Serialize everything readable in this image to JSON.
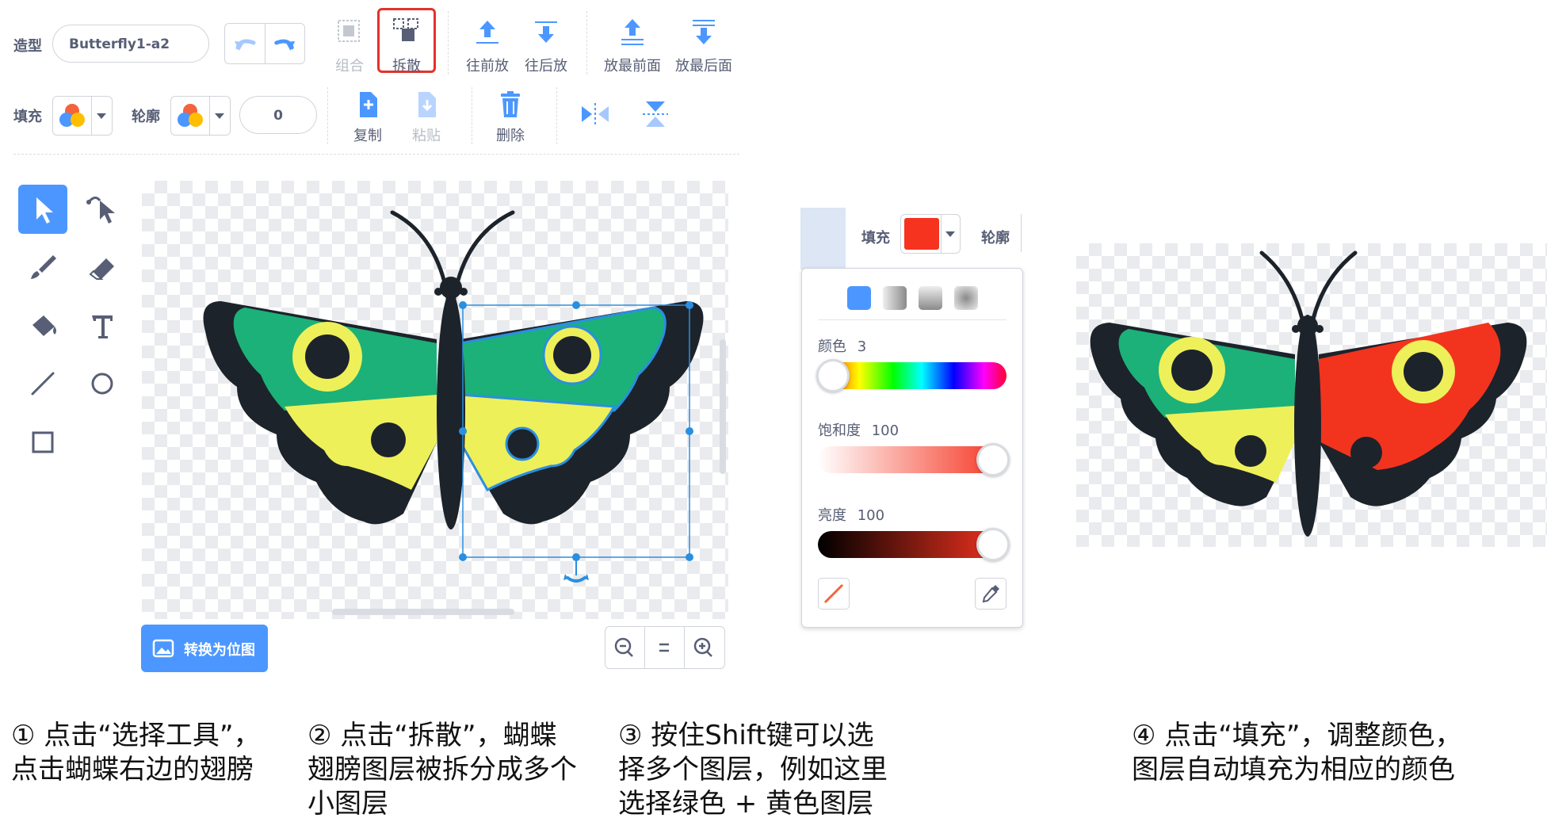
{
  "toolbar": {
    "costume_label": "造型",
    "costume_name": "Butterfly1-a2",
    "group_label": "组合",
    "ungroup_label": "拆散",
    "forward_label": "往前放",
    "backward_label": "往后放",
    "front_label": "放最前面",
    "back_label": "放最后面",
    "fill_label": "填充",
    "outline_label": "轮廓",
    "outline_width": "0",
    "copy_label": "复制",
    "paste_label": "粘贴",
    "delete_label": "删除"
  },
  "tools": [
    {
      "name": "select-tool",
      "active": true
    },
    {
      "name": "reshape-tool"
    },
    {
      "name": "brush-tool"
    },
    {
      "name": "eraser-tool"
    },
    {
      "name": "fill-tool"
    },
    {
      "name": "text-tool"
    },
    {
      "name": "line-tool"
    },
    {
      "name": "circle-tool"
    },
    {
      "name": "rectangle-tool"
    }
  ],
  "canvas": {
    "convert_button_label": "转换为位图"
  },
  "picker": {
    "fill_label": "填充",
    "outline_label": "轮廓",
    "fill_color": "#f5331f",
    "color_label": "颜色",
    "color_value": "3",
    "saturation_label": "饱和度",
    "saturation_value": "100",
    "brightness_label": "亮度",
    "brightness_value": "100"
  },
  "colors": {
    "accent": "#4c97ff",
    "highlight_border": "#e3322b",
    "wing_green": "#1cb179",
    "wing_yellow": "#eef05a",
    "wing_red": "#f2341f",
    "body_dark": "#1d232b"
  },
  "captions": [
    "① 点击“选择工具”，\n点击蝴蝶右边的翅膀",
    "② 点击“拆散”，蝴蝶\n翅膀图层被拆分成多个\n小图层",
    "③ 按住Shift键可以选\n择多个图层，例如这里\n选择绿色 + 黄色图层",
    "④ 点击“填充”，调整颜色，\n图层自动填充为相应的颜色"
  ]
}
